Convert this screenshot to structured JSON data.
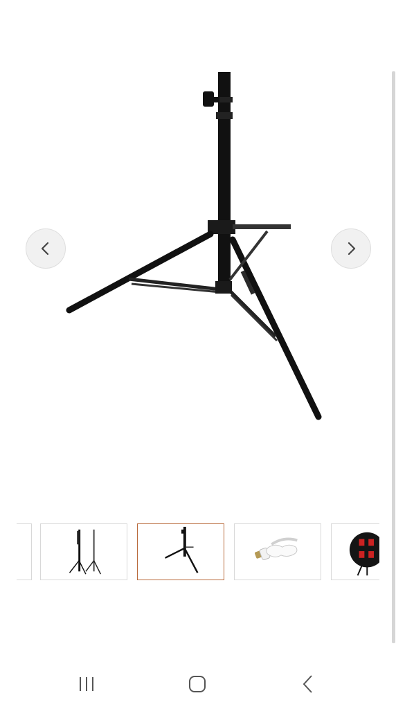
{
  "gallery": {
    "main_image": {
      "icon": "light-stand-tripod",
      "alt": ""
    },
    "prev_icon": "chevron-left-icon",
    "next_icon": "chevron-right-icon",
    "thumbnails": [
      {
        "name": "thumbnail-partial",
        "icon": "partial-image",
        "selected": false
      },
      {
        "name": "thumbnail-two-stands",
        "icon": "two-light-stands",
        "selected": false
      },
      {
        "name": "thumbnail-stand",
        "icon": "light-stand",
        "selected": true
      },
      {
        "name": "thumbnail-bulb",
        "icon": "cfl-bulb",
        "selected": false
      },
      {
        "name": "thumbnail-softbox",
        "icon": "softbox-socket",
        "selected": false
      }
    ]
  },
  "system_nav": {
    "recents_icon": "recent-apps-icon",
    "home_icon": "home-icon",
    "back_icon": "back-icon"
  },
  "colors": {
    "selected_border": "#b8693a",
    "stand_black": "#111111"
  }
}
